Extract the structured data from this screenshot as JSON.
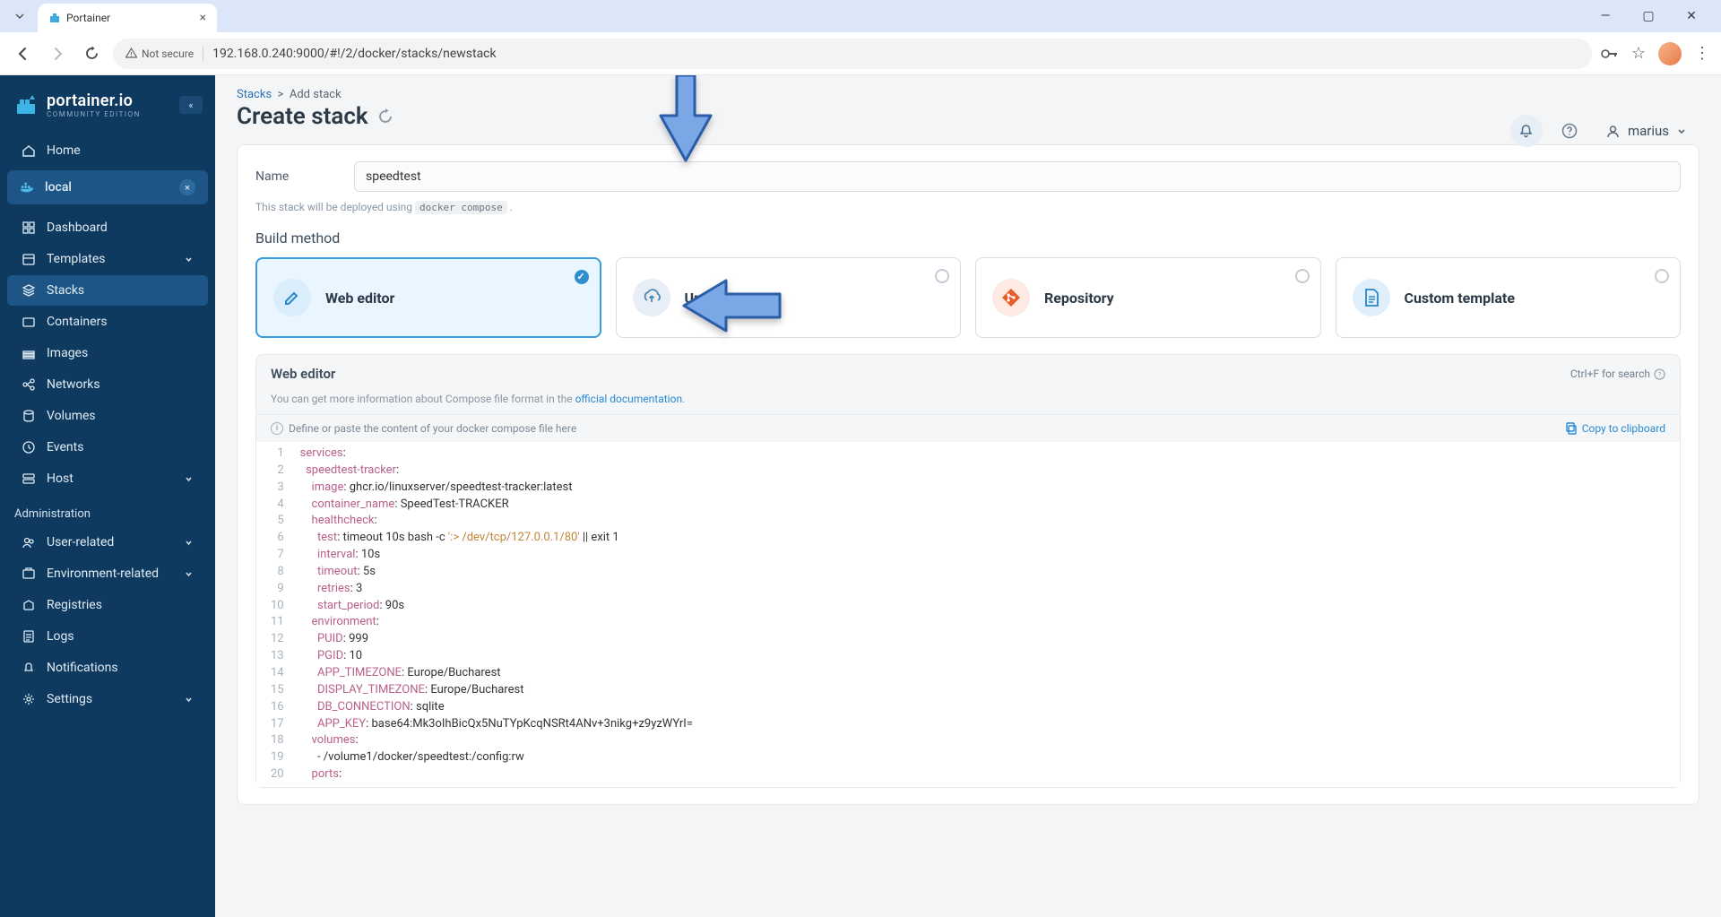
{
  "browser": {
    "tab_title": "Portainer",
    "not_secure": "Not secure",
    "url": "192.168.0.240:9000/#!/2/docker/stacks/newstack"
  },
  "sidebar": {
    "brand": "portainer.io",
    "edition": "COMMUNITY EDITION",
    "home": "Home",
    "env_name": "local",
    "items": [
      "Dashboard",
      "Templates",
      "Stacks",
      "Containers",
      "Images",
      "Networks",
      "Volumes",
      "Events",
      "Host"
    ],
    "admin_title": "Administration",
    "admin_items": [
      "User-related",
      "Environment-related",
      "Registries",
      "Logs",
      "Notifications",
      "Settings"
    ]
  },
  "topbar": {
    "crumb_link": "Stacks",
    "crumb_sep": ">",
    "crumb_current": "Add stack",
    "user": "marius"
  },
  "page": {
    "title": "Create stack"
  },
  "form": {
    "name_label": "Name",
    "name_value": "speedtest",
    "help_prefix": "This stack will be deployed using ",
    "help_code": "docker compose",
    "help_suffix": " .",
    "build_method": "Build method",
    "methods": {
      "web_editor": "Web editor",
      "upload": "Upload",
      "repository": "Repository",
      "custom_template": "Custom template"
    }
  },
  "editor": {
    "title": "Web editor",
    "search_hint": "Ctrl+F for search",
    "desc_prefix": "You can get more information about Compose file format in the ",
    "desc_link": "official documentation",
    "desc_suffix": ".",
    "placeholder_hint": "Define or paste the content of your docker compose file here",
    "copy": "Copy to clipboard",
    "lines": [
      {
        "n": 1,
        "html": "<span class='k'>services</span><span class='op'>:</span>"
      },
      {
        "n": 2,
        "html": "  <span class='k'>speedtest-tracker</span><span class='op'>:</span>"
      },
      {
        "n": 3,
        "html": "    <span class='k'>image</span><span class='op'>:</span> <span class='n'>ghcr.io/linuxserver/speedtest-tracker:latest</span>"
      },
      {
        "n": 4,
        "html": "    <span class='k'>container_name</span><span class='op'>:</span> <span class='n'>SpeedTest-TRACKER</span>"
      },
      {
        "n": 5,
        "html": "    <span class='k'>healthcheck</span><span class='op'>:</span>"
      },
      {
        "n": 6,
        "html": "      <span class='k'>test</span><span class='op'>:</span> <span class='n'>timeout 10s bash -c</span> <span class='str2'>':&gt; /dev/tcp/127.0.0.1/80'</span> <span class='n'>|| exit 1</span>"
      },
      {
        "n": 7,
        "html": "      <span class='k'>interval</span><span class='op'>:</span> <span class='n'>10s</span>"
      },
      {
        "n": 8,
        "html": "      <span class='k'>timeout</span><span class='op'>:</span> <span class='n'>5s</span>"
      },
      {
        "n": 9,
        "html": "      <span class='k'>retries</span><span class='op'>:</span> <span class='n'>3</span>"
      },
      {
        "n": 10,
        "html": "      <span class='k'>start_period</span><span class='op'>:</span> <span class='n'>90s</span>"
      },
      {
        "n": 11,
        "html": "    <span class='k'>environment</span><span class='op'>:</span>"
      },
      {
        "n": 12,
        "html": "      <span class='k'>PUID</span><span class='op'>:</span> <span class='n'>999</span>"
      },
      {
        "n": 13,
        "html": "      <span class='k'>PGID</span><span class='op'>:</span> <span class='n'>10</span>"
      },
      {
        "n": 14,
        "html": "      <span class='k'>APP_TIMEZONE</span><span class='op'>:</span> <span class='n'>Europe/Bucharest</span>"
      },
      {
        "n": 15,
        "html": "      <span class='k'>DISPLAY_TIMEZONE</span><span class='op'>:</span> <span class='n'>Europe/Bucharest</span>"
      },
      {
        "n": 16,
        "html": "      <span class='k'>DB_CONNECTION</span><span class='op'>:</span> <span class='n'>sqlite</span>"
      },
      {
        "n": 17,
        "html": "      <span class='k'>APP_KEY</span><span class='op'>:</span> <span class='n'>base64:Mk3oIhBicQx5NuTYpKcqNSRt4ANv+3nikg+z9yzWYrI=</span>"
      },
      {
        "n": 18,
        "html": "    <span class='k'>volumes</span><span class='op'>:</span>"
      },
      {
        "n": 19,
        "html": "      <span class='n'>- /volume1/docker/speedtest:/config:rw</span>"
      },
      {
        "n": 20,
        "html": "    <span class='k'>ports</span><span class='op'>:</span>"
      }
    ]
  }
}
